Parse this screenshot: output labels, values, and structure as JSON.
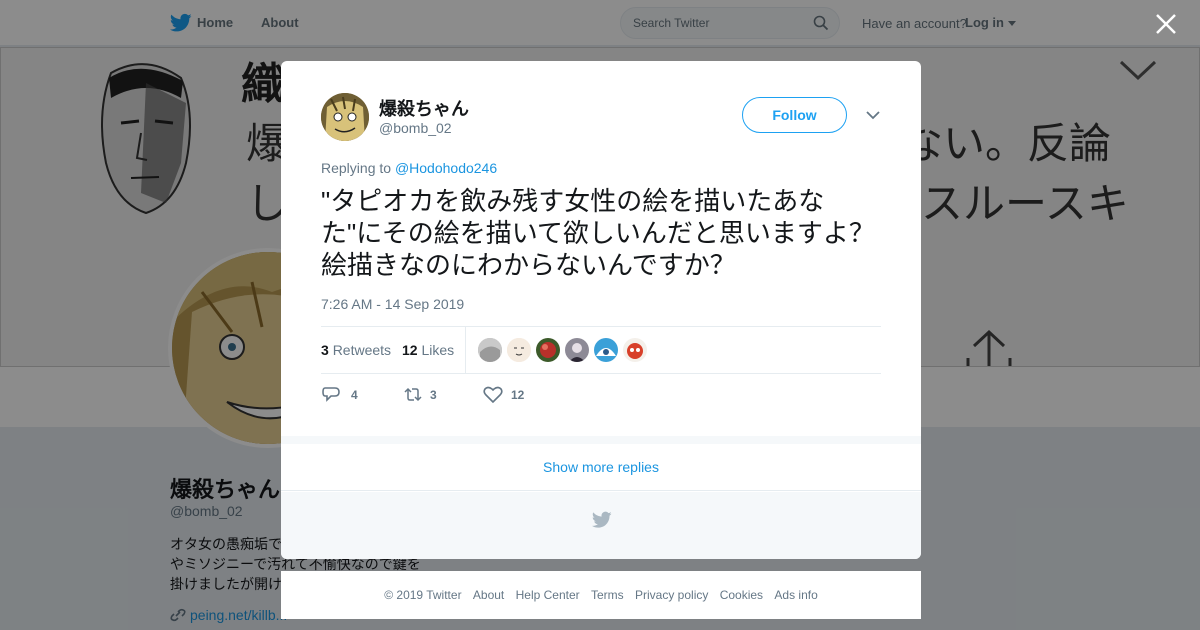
{
  "topbar": {
    "home_label": "Home",
    "about_label": "About",
    "search_placeholder": "Search Twitter",
    "account_prompt": "Have an account?",
    "login_label": "Log in"
  },
  "banner": {
    "line1": "織田三郎 @…",
    "line2": "爆",
    "line2_right": "ない。反論",
    "line3": "し",
    "line3_right": "スルースキ"
  },
  "profile": {
    "name": "爆殺ちゃん",
    "handle": "@bomb_02",
    "bio_line1": "オタ女の愚痴垢で",
    "bio_line2": "やミソジニーで汚れて不愉快なので鍵を",
    "bio_line3": "掛けましたが開け",
    "link": "peing.net/killb..."
  },
  "tweet": {
    "author_name": "爆殺ちゃん",
    "author_handle": "@bomb_02",
    "follow_label": "Follow",
    "replying_prefix": "Replying to",
    "replying_to": "@Hodohodo246",
    "text": "\"タピオカを飲み残す女性の絵を描いたあなた\"にその絵を描いて欲しいんだと思いますよ？ 絵描きなのにわからないんですか？",
    "timestamp": "7:26 AM - 14 Sep 2019",
    "retweets_count": "3",
    "retweets_label": "Retweets",
    "likes_count": "12",
    "likes_label": "Likes",
    "replies_action_count": "4",
    "retweets_action_count": "3",
    "likes_action_count": "12"
  },
  "show_more_label": "Show more replies",
  "footer": {
    "copyright": "© 2019 Twitter",
    "about": "About",
    "help": "Help Center",
    "terms": "Terms",
    "privacy": "Privacy policy",
    "cookies": "Cookies",
    "ads": "Ads info"
  },
  "colors": {
    "accent": "#1da1f2",
    "link": "#1b95e0",
    "muted": "#657786"
  },
  "icons": [
    "twitter-bird-icon",
    "search-icon",
    "close-icon",
    "chevron-down-icon",
    "reply-icon",
    "retweet-icon",
    "heart-icon",
    "link-icon",
    "upload-arrow-icon"
  ]
}
